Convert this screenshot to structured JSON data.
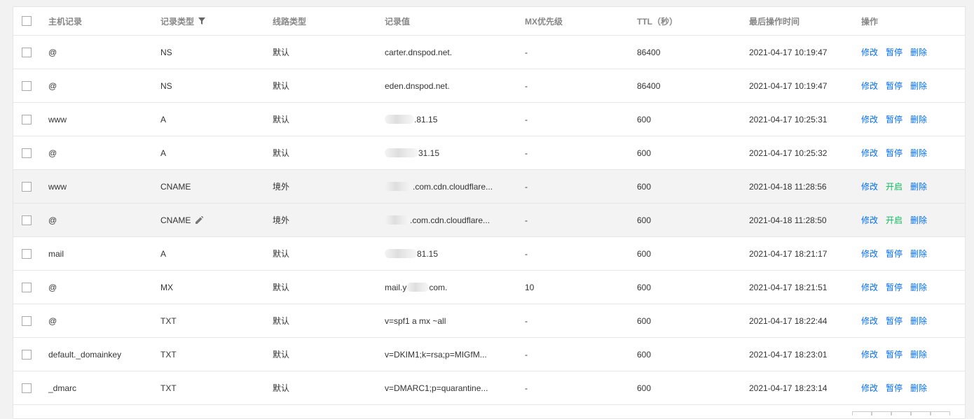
{
  "headers": {
    "host": "主机记录",
    "type": "记录类型",
    "line": "线路类型",
    "value": "记录值",
    "mx": "MX优先级",
    "ttl": "TTL（秒）",
    "time": "最后操作时间",
    "ops": "操作"
  },
  "ops_labels": {
    "edit": "修改",
    "pause": "暂停",
    "start": "开启",
    "delete": "删除"
  },
  "records": [
    {
      "host": "@",
      "type": "NS",
      "line": "默认",
      "value_pre": "",
      "value": "carter.dnspod.net.",
      "mx": "-",
      "ttl": "86400",
      "time": "2021-04-17 10:19:47",
      "status": "enabled",
      "toggle": "暂停"
    },
    {
      "host": "@",
      "type": "NS",
      "line": "默认",
      "value_pre": "",
      "value": "eden.dnspod.net.",
      "mx": "-",
      "ttl": "86400",
      "time": "2021-04-17 10:19:47",
      "status": "enabled",
      "toggle": "暂停"
    },
    {
      "host": "www",
      "type": "A",
      "line": "默认",
      "value_pre": "redacted",
      "value": ".81.15",
      "mx": "-",
      "ttl": "600",
      "time": "2021-04-17 10:25:31",
      "status": "enabled",
      "toggle": "暂停"
    },
    {
      "host": "@",
      "type": "A",
      "line": "默认",
      "value_pre": "redacted",
      "value": "31.15",
      "mx": "-",
      "ttl": "600",
      "time": "2021-04-17 10:25:32",
      "status": "enabled",
      "toggle": "暂停"
    },
    {
      "host": "www",
      "type": "CNAME",
      "line": "境外",
      "value_pre": "redacted",
      "value": ".com.cdn.cloudflare...",
      "mx": "-",
      "ttl": "600",
      "time": "2021-04-18 11:28:56",
      "status": "paused",
      "toggle": "开启"
    },
    {
      "host": "@",
      "type": "CNAME",
      "line": "境外",
      "value_pre": "redacted",
      "value": ".com.cdn.cloudflare...",
      "mx": "-",
      "ttl": "600",
      "time": "2021-04-18 11:28:50",
      "status": "paused",
      "toggle": "开启",
      "editable_type": true
    },
    {
      "host": "mail",
      "type": "A",
      "line": "默认",
      "value_pre": "redacted",
      "value": "81.15",
      "mx": "-",
      "ttl": "600",
      "time": "2021-04-17 18:21:17",
      "status": "enabled",
      "toggle": "暂停"
    },
    {
      "host": "@",
      "type": "MX",
      "line": "默认",
      "value_pre": "mail.y",
      "value_mid": "redacted",
      "value": "com.",
      "mx": "10",
      "ttl": "600",
      "time": "2021-04-17 18:21:51",
      "status": "enabled",
      "toggle": "暂停"
    },
    {
      "host": "@",
      "type": "TXT",
      "line": "默认",
      "value_pre": "",
      "value": "v=spf1 a mx ~all",
      "mx": "-",
      "ttl": "600",
      "time": "2021-04-17 18:22:44",
      "status": "enabled",
      "toggle": "暂停"
    },
    {
      "host": "default._domainkey",
      "type": "TXT",
      "line": "默认",
      "value_pre": "",
      "value": "v=DKIM1;k=rsa;p=MIGfM...",
      "mx": "-",
      "ttl": "600",
      "time": "2021-04-17 18:23:01",
      "status": "enabled",
      "toggle": "暂停"
    },
    {
      "host": "_dmarc",
      "type": "TXT",
      "line": "默认",
      "value_pre": "",
      "value": "v=DMARC1;p=quarantine...",
      "mx": "-",
      "ttl": "600",
      "time": "2021-04-17 18:23:14",
      "status": "enabled",
      "toggle": "暂停"
    }
  ],
  "colors": {
    "link": "#006eff",
    "start": "#0abf5b",
    "paused_row": "#f3f3f3"
  }
}
